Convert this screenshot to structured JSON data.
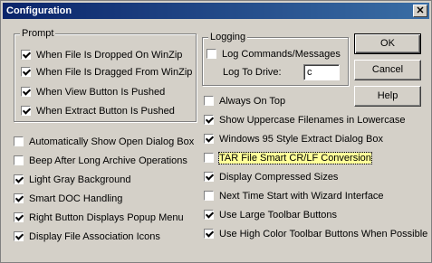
{
  "window": {
    "title": "Configuration",
    "close_glyph": "✕"
  },
  "prompt": {
    "title": "Prompt",
    "items": [
      {
        "label": "When File Is Dropped On WinZip",
        "checked": true
      },
      {
        "label": "When File Is Dragged From WinZip",
        "checked": true
      },
      {
        "label": "When View Button Is Pushed",
        "checked": true
      },
      {
        "label": "When Extract Button Is Pushed",
        "checked": true
      }
    ]
  },
  "logging": {
    "title": "Logging",
    "log_commands_label": "Log Commands/Messages",
    "log_commands_checked": false,
    "drive_label": "Log To Drive:",
    "drive_value": "c"
  },
  "buttons": {
    "ok": "OK",
    "cancel": "Cancel",
    "help": "Help"
  },
  "left_options": [
    {
      "label": "Automatically Show Open Dialog Box",
      "checked": false
    },
    {
      "label": "Beep After Long Archive Operations",
      "checked": false
    },
    {
      "label": "Light Gray Background",
      "checked": true
    },
    {
      "label": "Smart DOC Handling",
      "checked": true
    },
    {
      "label": "Right Button Displays Popup Menu",
      "checked": true
    },
    {
      "label": "Display File Association Icons",
      "checked": true
    }
  ],
  "right_options": [
    {
      "label": "Always On Top",
      "checked": false
    },
    {
      "label": "Show Uppercase Filenames in Lowercase",
      "checked": true
    },
    {
      "label": "Windows 95 Style Extract Dialog Box",
      "checked": true
    },
    {
      "label": "TAR File Smart CR/LF Conversion",
      "checked": false,
      "focused": true
    },
    {
      "label": "Display Compressed Sizes",
      "checked": true
    },
    {
      "label": "Next Time Start with Wizard Interface",
      "checked": false
    },
    {
      "label": "Use Large Toolbar Buttons",
      "checked": true
    },
    {
      "label": "Use High Color Toolbar Buttons When Possible",
      "checked": true
    }
  ]
}
